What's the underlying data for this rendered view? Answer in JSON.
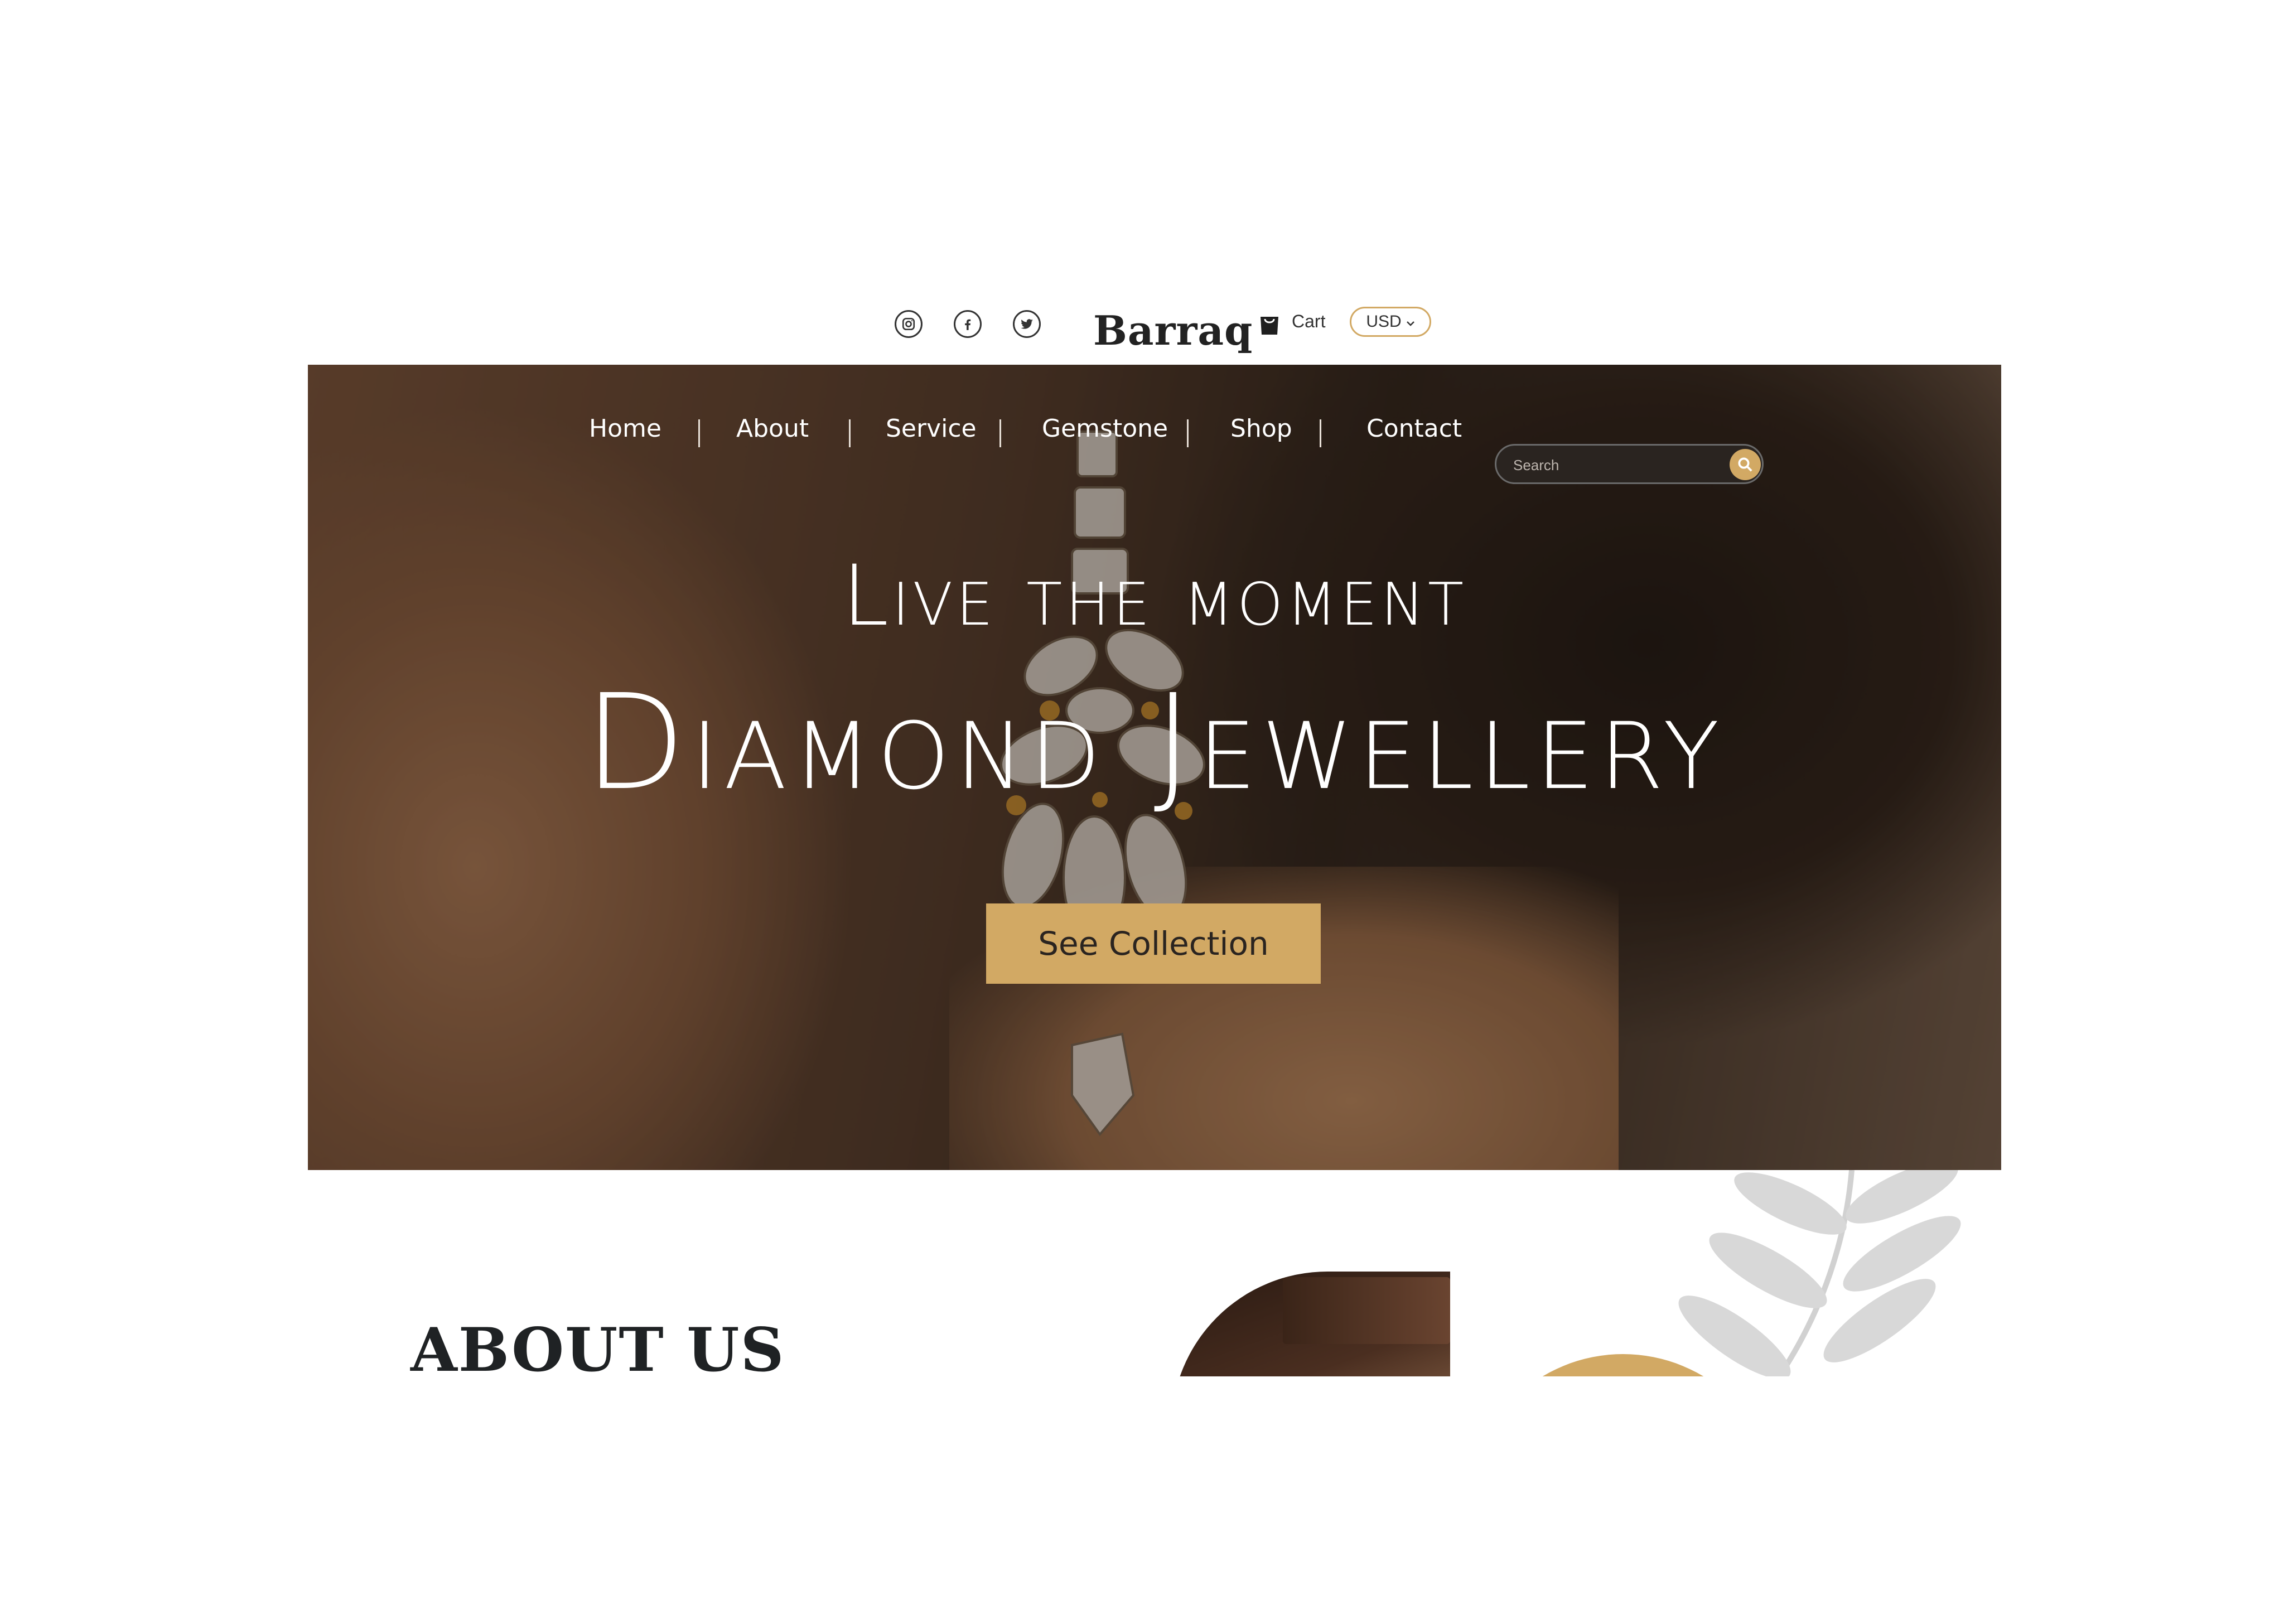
{
  "header": {
    "social": [
      {
        "name": "instagram",
        "icon": "instagram-icon"
      },
      {
        "name": "facebook",
        "icon": "facebook-icon"
      },
      {
        "name": "twitter",
        "icon": "twitter-icon"
      }
    ],
    "logo": "Barraq",
    "cart_label": "Cart",
    "cart_icon": "shopping-bag-icon",
    "currency": "USD"
  },
  "nav": {
    "items": [
      "Home",
      "About",
      "Service",
      "Gemstone",
      "Shop",
      "Contact"
    ],
    "search_placeholder": "Search",
    "search_icon": "search-icon"
  },
  "hero": {
    "subtitle": "Live the moment",
    "title": "Diamond Jewellery",
    "cta": "See Collection"
  },
  "about": {
    "title": "ABOUT US"
  },
  "colors": {
    "accent": "#d2a964",
    "text_dark": "#1f2224",
    "hero_dark": "#2a1f18"
  }
}
